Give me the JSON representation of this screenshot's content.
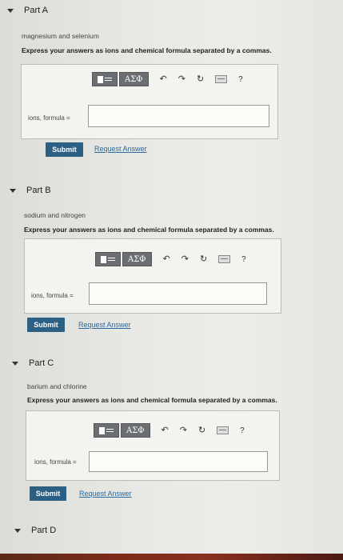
{
  "parts": [
    {
      "title": "Part A",
      "prompt": "magnesium and selenium",
      "instruction": "Express your answers as ions and chemical formula separated by a commas.",
      "answer_label": "ions, formula =",
      "input_value": "",
      "submit_label": "Submit",
      "request_label": "Request Answer"
    },
    {
      "title": "Part B",
      "prompt": "sodium and nitrogen",
      "instruction": "Express your answers as ions and chemical formula separated by a commas.",
      "answer_label": "ions, formula =",
      "input_value": "",
      "submit_label": "Submit",
      "request_label": "Request Answer"
    },
    {
      "title": "Part C",
      "prompt": "barium and chlorine",
      "instruction": "Express your answers as ions and chemical formula separated by a commas.",
      "answer_label": "ions, formula =",
      "input_value": "",
      "submit_label": "Submit",
      "request_label": "Request Answer"
    },
    {
      "title": "Part D"
    }
  ],
  "toolbar": {
    "symbols_label": "ΑΣΦ",
    "undo_glyph": "↶",
    "redo_glyph": "↷",
    "reset_glyph": "↻",
    "help_glyph": "?",
    "icons": [
      "templates-icon",
      "greek-symbols-icon",
      "undo-icon",
      "redo-icon",
      "reset-icon",
      "keyboard-icon",
      "help-icon"
    ]
  },
  "colors": {
    "submit_bg": "#2b5f83",
    "link": "#2a6aa0",
    "toolbar_button": "#6b6f73"
  }
}
